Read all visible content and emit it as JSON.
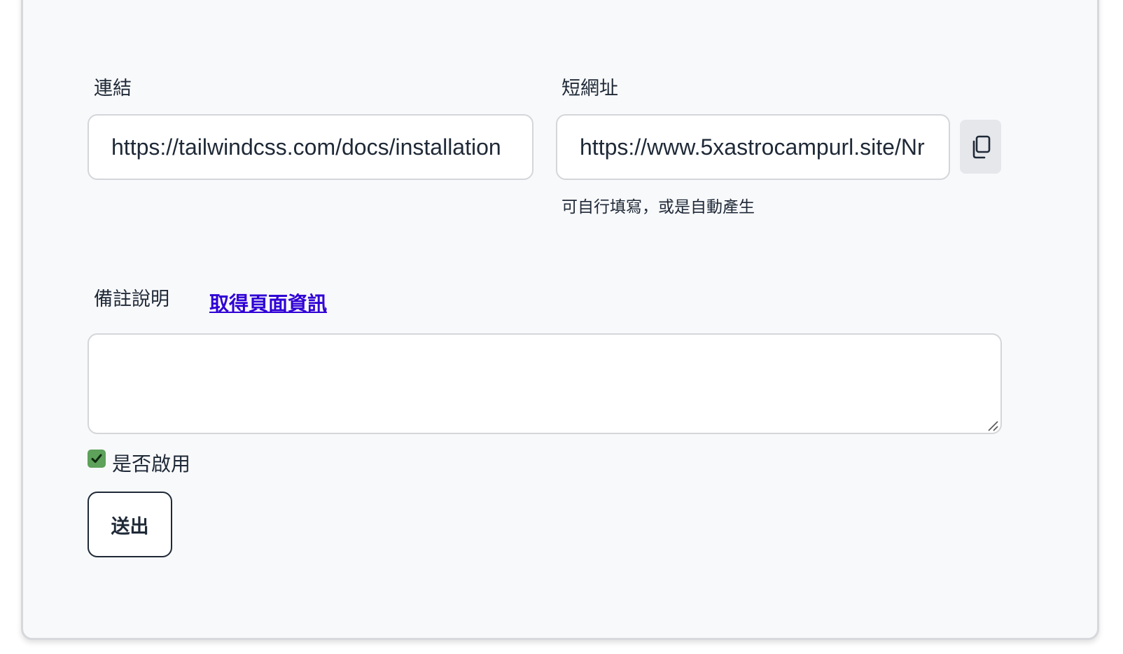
{
  "form": {
    "link_label": "連結",
    "link_value": "https://tailwindcss.com/docs/installation",
    "short_label": "短網址",
    "short_value": "https://www.5xastrocampurl.site/Nr",
    "copy_icon": "copy-icon",
    "short_hint": "可自行填寫，或是自動產生",
    "note_label": "備註說明",
    "fetch_link": "取得頁面資訊",
    "note_value": "",
    "enable_checked": true,
    "enable_label": "是否啟用",
    "submit_label": "送出"
  },
  "colors": {
    "accent_link": "#2f00d6",
    "checkbox": "#5da15a",
    "card_bg": "#f8f9fb",
    "button_bg": "#e5e7eb"
  }
}
